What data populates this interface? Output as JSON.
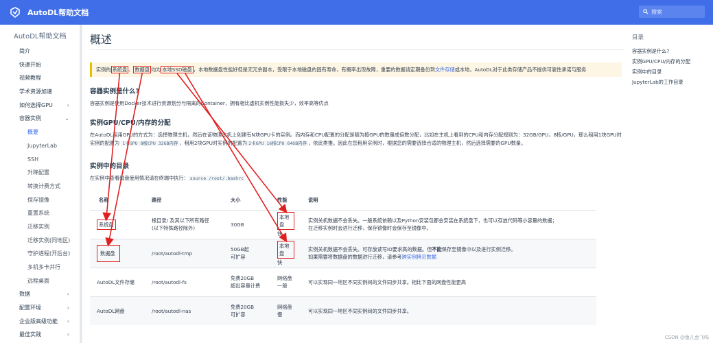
{
  "topbar": {
    "brand": "AutoDL帮助文档",
    "search_placeholder": "搜索"
  },
  "sidebar": {
    "title": "AutoDL帮助文档",
    "items": [
      {
        "label": "简介",
        "level": 1,
        "chevron": ""
      },
      {
        "label": "快速开始",
        "level": 1,
        "chevron": ""
      },
      {
        "label": "视频教程",
        "level": 1,
        "chevron": ""
      },
      {
        "label": "学术资源加速",
        "level": 1,
        "chevron": ""
      },
      {
        "label": "如何选择GPU",
        "level": 1,
        "chevron": "›"
      },
      {
        "label": "容器实例",
        "level": 1,
        "chevron": "⌄"
      },
      {
        "label": "概要",
        "level": 2,
        "chevron": "",
        "active": true
      },
      {
        "label": "JupyterLab",
        "level": 2,
        "chevron": ""
      },
      {
        "label": "SSH",
        "level": 2,
        "chevron": ""
      },
      {
        "label": "升降配置",
        "level": 2,
        "chevron": ""
      },
      {
        "label": "转换计费方式",
        "level": 2,
        "chevron": ""
      },
      {
        "label": "保存镜像",
        "level": 2,
        "chevron": ""
      },
      {
        "label": "重置系统",
        "level": 2,
        "chevron": ""
      },
      {
        "label": "迁移实例",
        "level": 2,
        "chevron": ""
      },
      {
        "label": "迁移实例(同地区)",
        "level": 2,
        "chevron": ""
      },
      {
        "label": "守护进程(开后台)",
        "level": 2,
        "chevron": ""
      },
      {
        "label": "多机多卡并行",
        "level": 2,
        "chevron": ""
      },
      {
        "label": "远程桌面",
        "level": 2,
        "chevron": ""
      },
      {
        "label": "数据",
        "level": 1,
        "chevron": "›"
      },
      {
        "label": "配置环境",
        "level": 1,
        "chevron": "›"
      },
      {
        "label": "企业版高级功能",
        "level": 1,
        "chevron": "›"
      },
      {
        "label": "最佳实践",
        "level": 1,
        "chevron": "›"
      }
    ]
  },
  "main": {
    "title": "概述",
    "notice": {
      "p1": "实例的",
      "hl1": "系统盘",
      "p2": "、",
      "hl2": "数据盘",
      "p3": "均为",
      "hl3": "本地SSD磁盘",
      "p4": "，本地数据盘性能好但是无冗余副本，受限于本地磁盘的固有寿命，有概率出现故障，重要的数据请定期备份到",
      "link": "文件存储",
      "p5": "或本地，AutoDL对于此类存储产品不提供可靠性承诺与服务"
    },
    "s1_title": "容器实例是什么?",
    "s1_text": "容器实例是使用Docker技术进行资源划分与隔离的Container，拥有相比虚机实例性能损失少，效率高等优点",
    "s2_title": "实例GPU/CPU/内存的分配",
    "s2": {
      "t1": "在AutoDL租用GPU的方式为：选择物理主机，然后在该物理主机上创建有N块GPU卡的实例。而内存和CPU配置的分配是随为按GPU的数量成倍数分配，比如在主机上看到的CPU和内存分配规则为：32GB/GPU，8核/GPU，那么租用1块GPU时实例的配置为",
      "c1": "1卡GPU",
      "c2": "8核CPU",
      "c3": "32GB内存",
      "t2": "，租用2块GPU时实例的配置为",
      "c4": "2卡GPU",
      "c5": "16核CPU",
      "c6": "64GB内存",
      "t3": "，依此类推。因此在您租用实例时，根据您的需要选择合适的物理主机，然后选择需要的GPU数量。"
    },
    "s3_title": "实例中的目录",
    "s3_text": "在实例中查看磁盘使用情况请在终端中执行：",
    "s3_code": "source /root/.bashrc",
    "table": {
      "headers": [
        "名称",
        "路径",
        "大小",
        "性能",
        "说明"
      ],
      "rows": [
        {
          "name": "系统盘",
          "path1": "根目录/ 及其以下所有路径",
          "path2": "(以下特殊路径除外)",
          "size1": "30GB",
          "size2": "",
          "perf1": "本地盘",
          "perf2": "快",
          "desc1": "实例关机数据不会丢失。一般系统依赖以及Python安装包都会安装在系统盘下，也可以存放代码等小容量的数据；",
          "desc2": "在迁移实例时会进行迁移，保存镜像时会保存至镜像中。",
          "desc_link": "",
          "bold": ""
        },
        {
          "name": "数据盘",
          "path1": "/root/autodl-tmp",
          "path2": "",
          "size1": "50GB起",
          "size2": "可扩容",
          "perf1": "本地盘",
          "perf2": "快",
          "desc1a": "实例关机数据不会丢失。可存放读写IO要求高的数据。但",
          "bold": "不能",
          "desc1b": "保存至镜像中以及进行实例迁移。",
          "desc2": "如果需要将数据盘的数据进行迁移，请参考",
          "desc_link": "跨实例拷贝数据"
        },
        {
          "name": "AutoDL文件存储",
          "path1": "/root/autodl-fs",
          "path2": "",
          "size1": "免费20GB",
          "size2": "超出容量计费",
          "perf1": "网络盘",
          "perf2": "一般",
          "desc1": "可以实现同一地区不同实例间的文件同步共享。相比下面的网盘性能更高",
          "desc2": ""
        },
        {
          "name": "AutoDL网盘",
          "path1": "/root/autodl-nas",
          "path2": "",
          "size1": "免费20GB",
          "size2": "可扩容",
          "perf1": "网络盘",
          "perf2": "慢",
          "desc1": "可以实现同一地区不同实例间的文件同步共享。",
          "desc2": ""
        }
      ]
    }
  },
  "toc": {
    "title": "目录",
    "items": [
      "容器实例是什么?",
      "实例GPU/CPU/内存的分配",
      "实例中的目录",
      "JupyterLab的工作目录"
    ]
  },
  "watermark": "CSDN @鱼儿会飞吗",
  "colors": {
    "topbar": "#3f6ee8",
    "accent": "#3f6ee8",
    "annotation": "#e02020",
    "notice_bg": "#fdf6e4"
  }
}
